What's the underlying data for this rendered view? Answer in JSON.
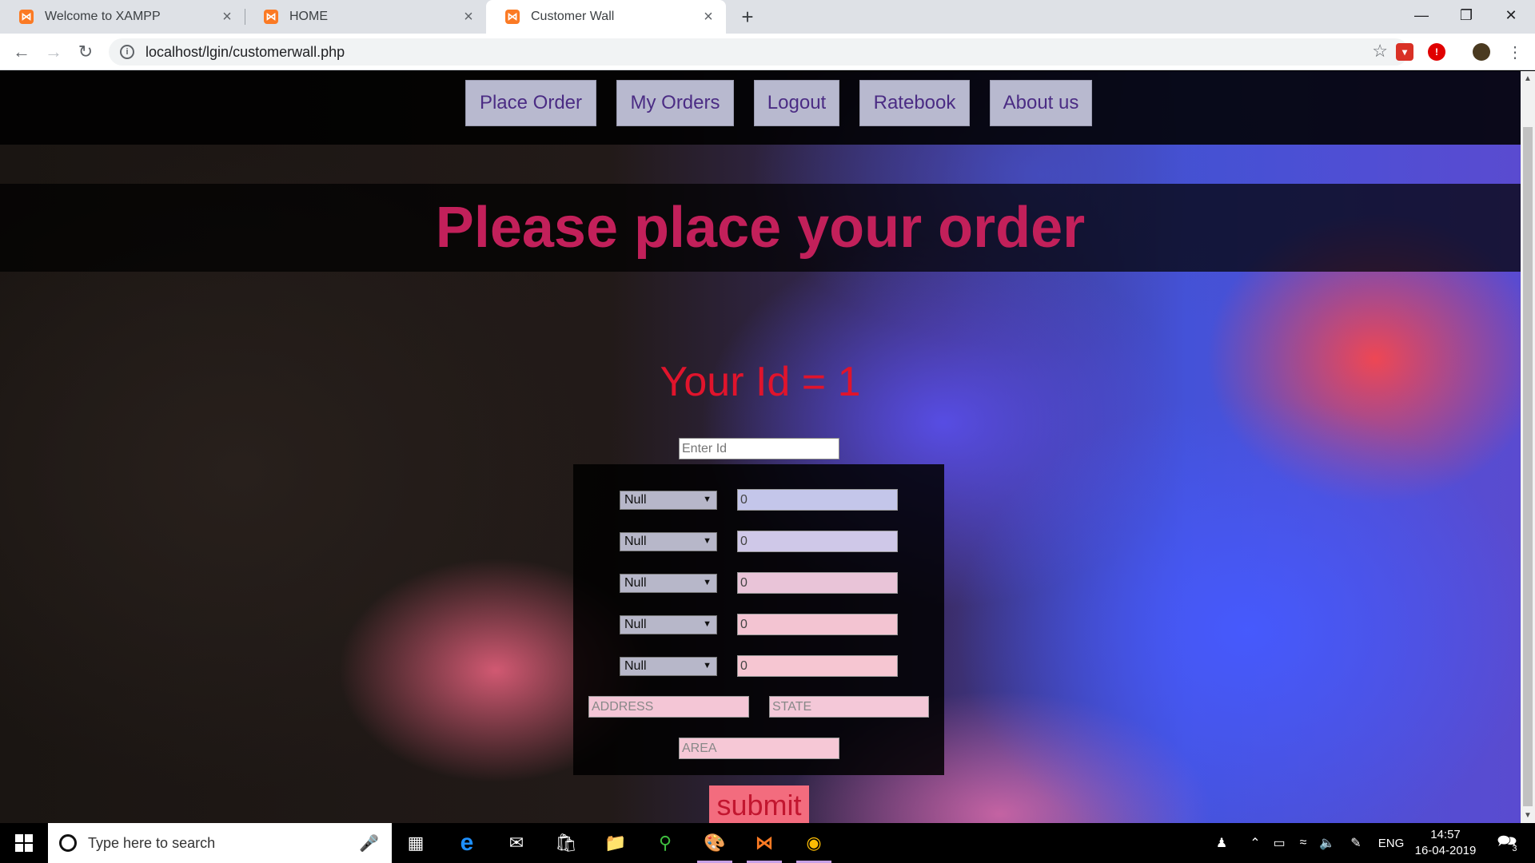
{
  "browser": {
    "tabs": [
      {
        "title": "Welcome to XAMPP",
        "active": false
      },
      {
        "title": "HOME",
        "active": false
      },
      {
        "title": "Customer Wall",
        "active": true
      }
    ],
    "url": "localhost/lgin/customerwall.php",
    "icons": {
      "back": "back-arrow-icon",
      "forward": "forward-arrow-icon",
      "reload": "reload-icon",
      "info": "info-icon",
      "bookmark": "star-icon",
      "menu": "kebab-menu-icon",
      "new_tab": "plus-icon",
      "minimize": "minimize-icon",
      "maximize": "restore-icon",
      "close": "close-icon"
    },
    "favicon_color": "#fb7a24"
  },
  "nav": {
    "buttons": [
      "Place Order",
      "My Orders",
      "Logout",
      "Ratebook",
      "About us"
    ]
  },
  "page": {
    "heading": "Please place your order",
    "your_id": "Your Id = 1",
    "enter_id_placeholder": "Enter Id",
    "order_rows": [
      {
        "item": "Null",
        "qty": "0"
      },
      {
        "item": "Null",
        "qty": "0"
      },
      {
        "item": "Null",
        "qty": "0"
      },
      {
        "item": "Null",
        "qty": "0"
      },
      {
        "item": "Null",
        "qty": "0"
      }
    ],
    "address_placeholder": "ADDRESS",
    "state_placeholder": "STATE",
    "area_placeholder": "AREA",
    "submit_label": "submit",
    "colors": {
      "heading": "#c2205a",
      "your_id": "#e0142c",
      "nav_button_bg": "#b8b9cf",
      "nav_button_text": "#4b2c84",
      "submit_bg": "#f36c7e",
      "submit_text": "#c2162f"
    }
  },
  "taskbar": {
    "search_placeholder": "Type here to search",
    "language": "ENG",
    "time": "14:57",
    "date": "16-04-2019",
    "notification_count": "3",
    "apps": [
      "task-view-icon",
      "edge-icon",
      "mail-icon",
      "store-icon",
      "file-explorer-icon",
      "app-icon",
      "paint-icon",
      "xampp-icon",
      "chrome-icon"
    ]
  }
}
